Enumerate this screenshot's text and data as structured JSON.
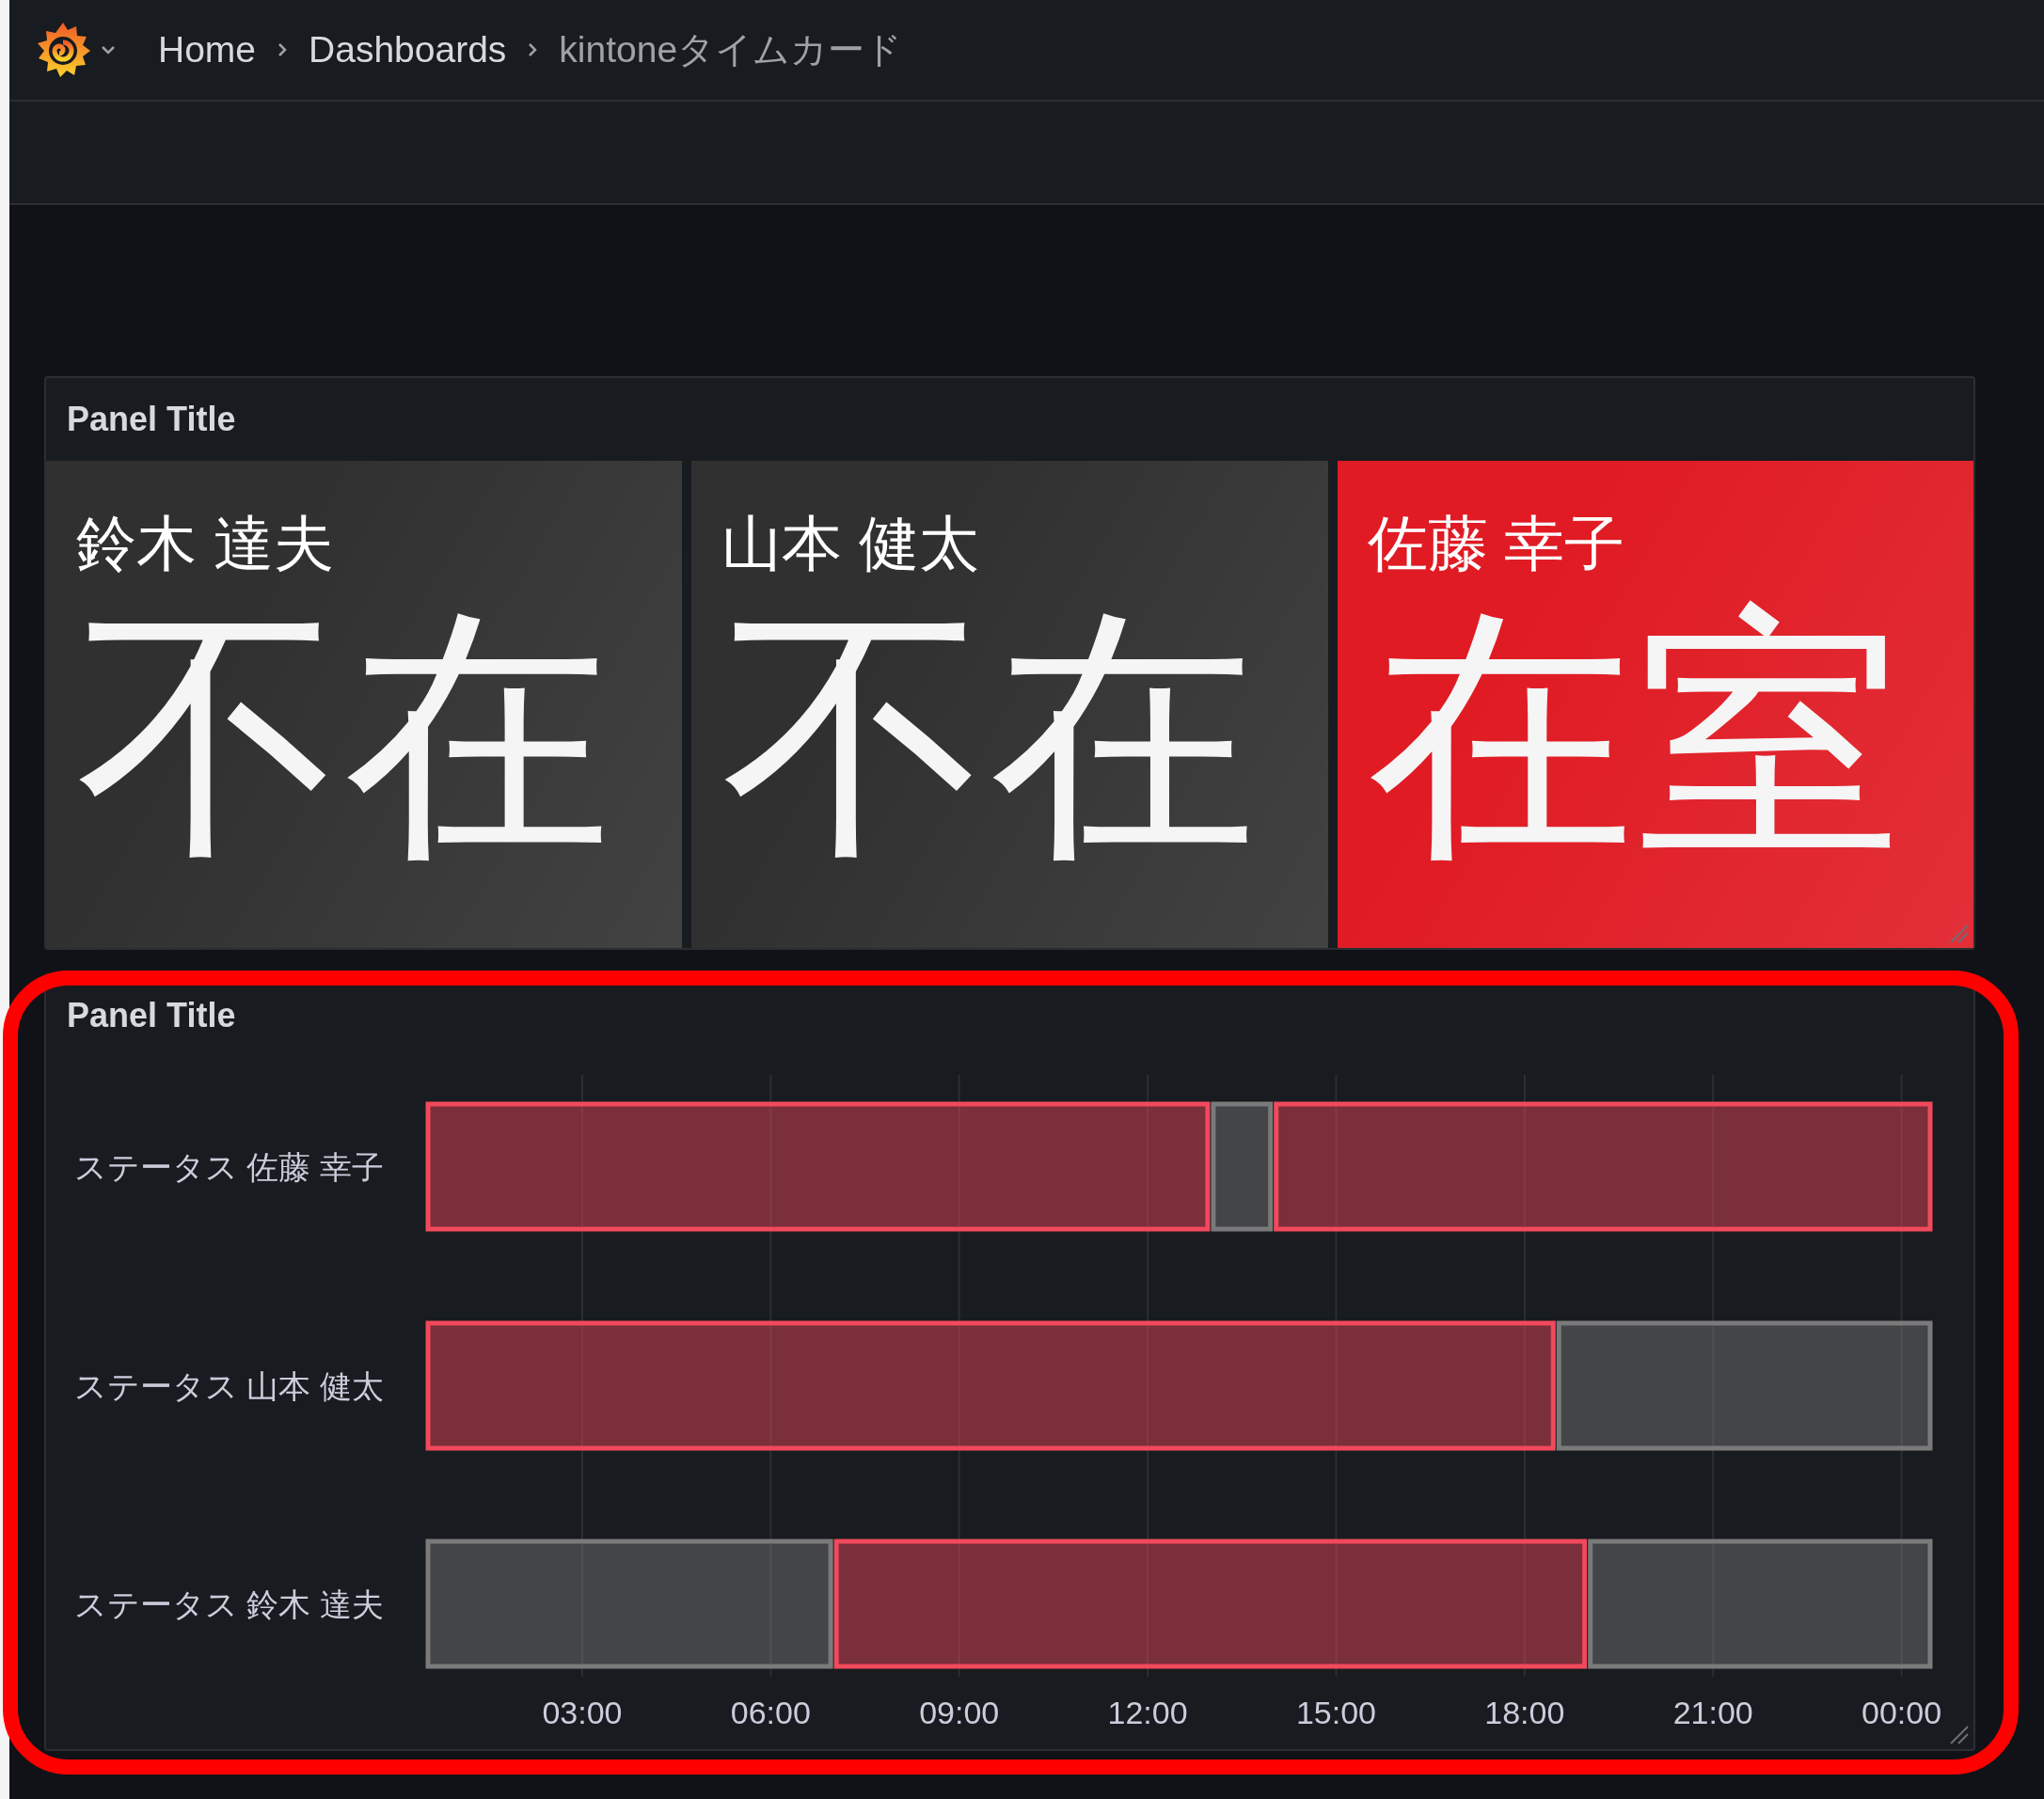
{
  "breadcrumbs": [
    {
      "label": "Home",
      "current": false
    },
    {
      "label": "Dashboards",
      "current": false
    },
    {
      "label": "kintoneタイムカード",
      "current": true
    }
  ],
  "stat_panel": {
    "title": "Panel Title",
    "tiles": [
      {
        "name": "鈴木 達夫",
        "value": "不在",
        "color": "#303030"
      },
      {
        "name": "山本 健太",
        "value": "不在",
        "color": "#303030"
      },
      {
        "name": "佐藤 幸子",
        "value": "在室",
        "color": "#e01b24"
      }
    ]
  },
  "timeline_panel": {
    "title": "Panel Title",
    "chart_data": {
      "type": "bar",
      "orientation": "horizontal",
      "stacked": true,
      "categories": [
        "ステータス 佐藤 幸子",
        "ステータス 山本 健太",
        "ステータス 鈴木 達夫"
      ],
      "series": [
        {
          "values": [
            13,
            18.5,
            7
          ],
          "colors": [
            "#f2495c",
            "#f2495c",
            "#7a7a7a"
          ]
        },
        {
          "values": [
            1,
            6,
            12
          ],
          "colors": [
            "#7a7a7a",
            "#7a7a7a",
            "#f2495c"
          ]
        },
        {
          "values": [
            10.5,
            null,
            5.5
          ],
          "colors": [
            "#f2495c",
            null,
            "#7a7a7a"
          ]
        }
      ],
      "xlim": [
        0.5,
        24.5
      ],
      "grid": true,
      "xticks": [
        {
          "value": 3,
          "label": "03:00"
        },
        {
          "value": 6,
          "label": "06:00"
        },
        {
          "value": 9,
          "label": "09:00"
        },
        {
          "value": 12,
          "label": "12:00"
        },
        {
          "value": 15,
          "label": "15:00"
        },
        {
          "value": 18,
          "label": "18:00"
        },
        {
          "value": 21,
          "label": "21:00"
        },
        {
          "value": 24,
          "label": "00:00"
        }
      ]
    }
  }
}
